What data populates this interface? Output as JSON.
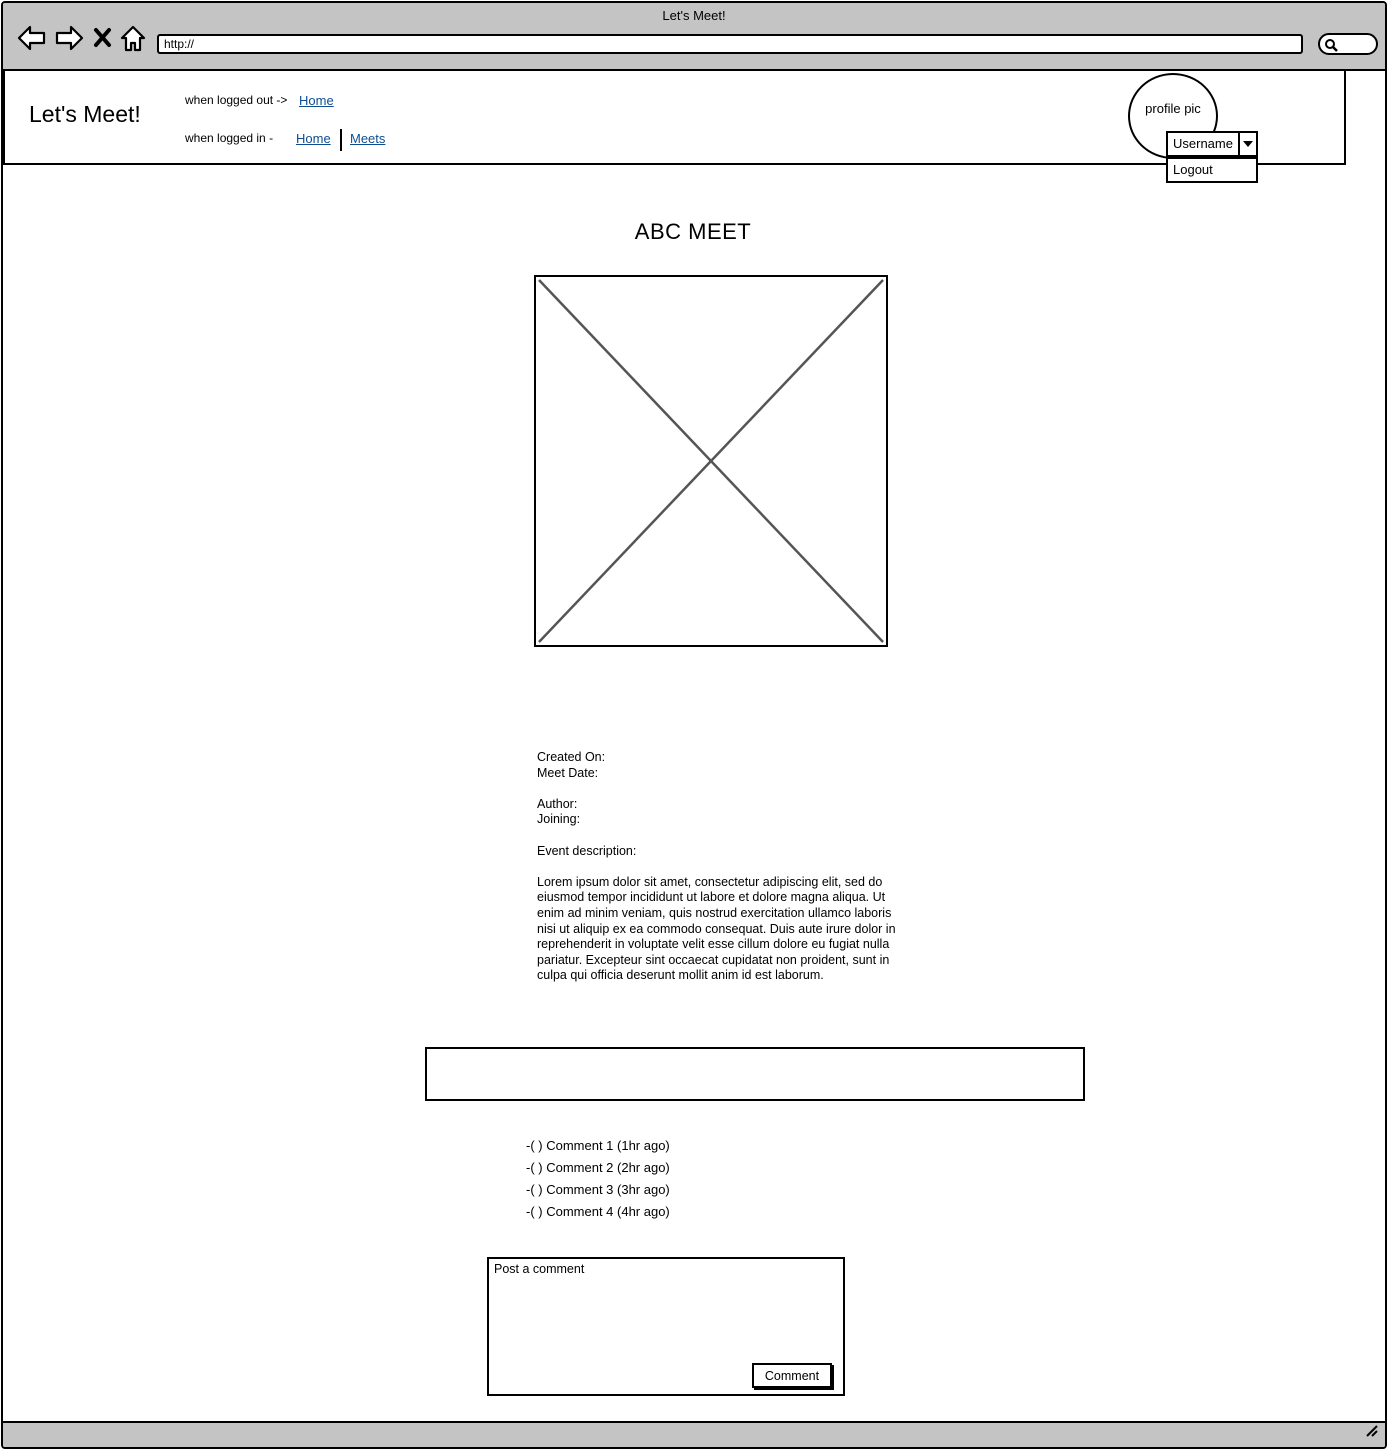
{
  "browser": {
    "window_title": "Let's Meet!",
    "url": "http://"
  },
  "header": {
    "brand": "Let's Meet!",
    "logged_out_label": "when logged out ->",
    "logged_out_links": {
      "home": "Home"
    },
    "logged_in_label": "when logged in -",
    "logged_in_links": {
      "home": "Home",
      "meets": "Meets"
    },
    "profile_pic_label": "profile pic",
    "user_select_value": "Username",
    "user_menu_item": "Logout"
  },
  "meet": {
    "title": "ABC MEET",
    "created_on_label": "Created On:",
    "meet_date_label": "Meet Date:",
    "author_label": "Author:",
    "joining_label": "Joining:",
    "description_label": "Event description:",
    "description": "Lorem ipsum dolor sit amet, consectetur adipiscing elit, sed do eiusmod tempor incididunt ut labore et dolore magna aliqua. Ut enim ad minim veniam, quis nostrud exercitation ullamco laboris nisi ut aliquip ex ea commodo consequat. Duis aute irure dolor in reprehenderit in voluptate velit esse cillum dolore eu fugiat nulla pariatur. Excepteur sint occaecat cupidatat non proident, sunt in culpa qui officia deserunt mollit anim id est laborum."
  },
  "comments": [
    "-( ) Comment 1 (1hr ago)",
    "-( ) Comment 2 (2hr ago)",
    "-( ) Comment 3 (3hr ago)",
    "-( ) Comment 4 (4hr ago)"
  ],
  "post_comment": {
    "placeholder": "Post a comment",
    "button_label": "Comment"
  }
}
